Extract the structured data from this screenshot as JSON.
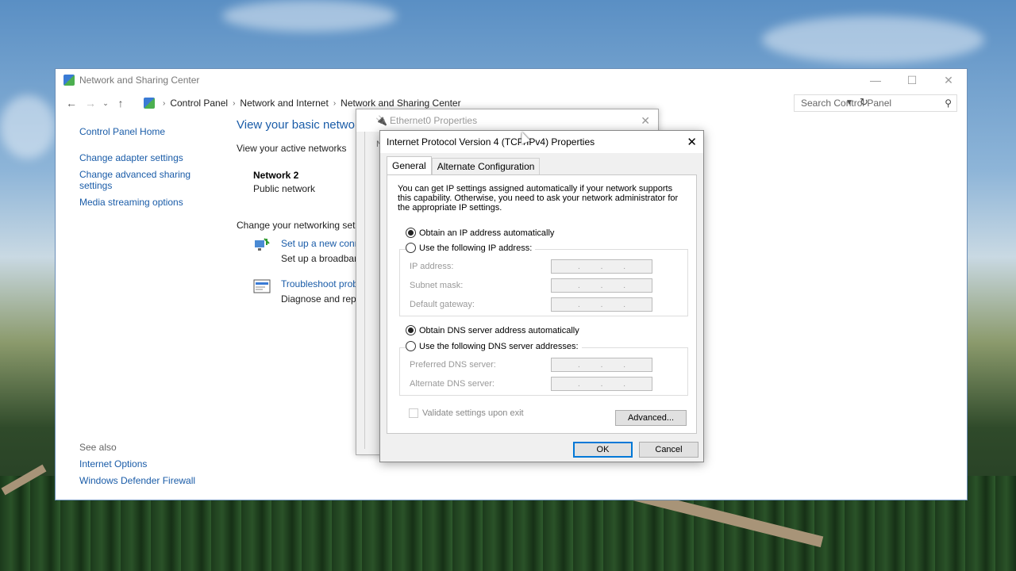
{
  "window": {
    "title": "Network and Sharing Center",
    "controls": {
      "minimize": "—",
      "maximize": "☐",
      "close": "✕"
    }
  },
  "addressbar": {
    "crumbs": [
      "Control Panel",
      "Network and Internet",
      "Network and Sharing Center"
    ],
    "search_placeholder": "Search Control Panel"
  },
  "left_pane": {
    "home": "Control Panel Home",
    "links": [
      "Change adapter settings",
      "Change advanced sharing settings",
      "Media streaming options"
    ]
  },
  "see_also": {
    "header": "See also",
    "links": [
      "Internet Options",
      "Windows Defender Firewall"
    ]
  },
  "main": {
    "title": "View your basic netwo",
    "active_networks_header": "View your active networks",
    "network_name": "Network 2",
    "network_type": "Public network",
    "change_header": "Change your networking set",
    "tasks": [
      {
        "link": "Set up a new conn",
        "desc": "Set up a broadban"
      },
      {
        "link": "Troubleshoot prob",
        "desc": "Diagnose and repa"
      }
    ],
    "fragment_letter": "N"
  },
  "eth_dialog": {
    "title": "Ethernet0 Properties",
    "close": "✕"
  },
  "ip_dialog": {
    "title": "Internet Protocol Version 4 (TCP/IPv4) Properties",
    "close": "✕",
    "tabs": [
      "General",
      "Alternate Configuration"
    ],
    "description": "You can get IP settings assigned automatically if your network supports this capability. Otherwise, you need to ask your network administrator for the appropriate IP settings.",
    "ip_auto": "Obtain an IP address automatically",
    "ip_manual": "Use the following IP address:",
    "ip_fields": [
      "IP address:",
      "Subnet mask:",
      "Default gateway:"
    ],
    "dns_auto": "Obtain DNS server address automatically",
    "dns_manual": "Use the following DNS server addresses:",
    "dns_fields": [
      "Preferred DNS server:",
      "Alternate DNS server:"
    ],
    "dot": ".",
    "validate": "Validate settings upon exit",
    "advanced": "Advanced...",
    "ok": "OK",
    "cancel": "Cancel"
  }
}
